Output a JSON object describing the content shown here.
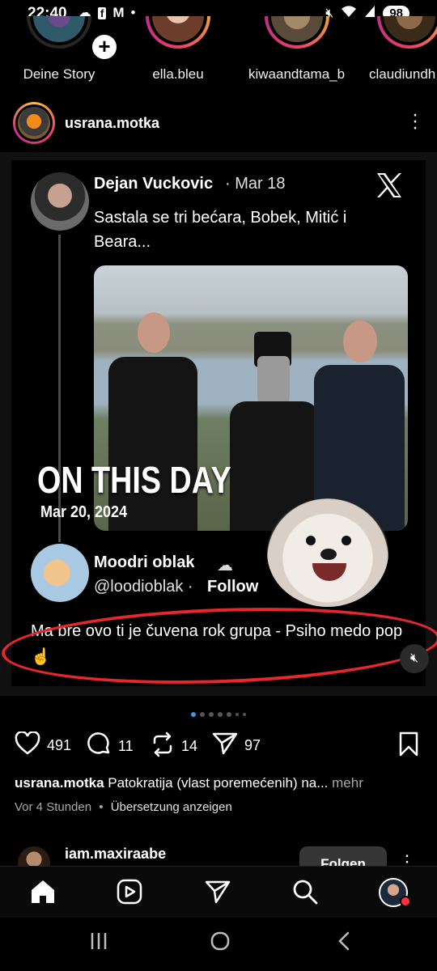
{
  "status": {
    "time": "22:40",
    "battery": "98",
    "left_icons": [
      "cloud-icon",
      "facebook-icon",
      "gmail-icon",
      "dot-icon"
    ],
    "right_icons": [
      "mute-icon",
      "wifi-icon",
      "signal-icon",
      "battery-icon"
    ]
  },
  "stories": [
    {
      "name": "Deine Story",
      "own": true
    },
    {
      "name": "ella.bleu"
    },
    {
      "name": "kiwaandtama_b..."
    },
    {
      "name": "claudiundh"
    }
  ],
  "post": {
    "username": "usrana.motka",
    "tweet": {
      "author": "Dejan Vuckovic",
      "date": "· Mar 18",
      "text": "Sastala se tri bećara, Bobek, Mitić i Beara...",
      "overlay_title": "ON THIS DAY",
      "overlay_date": "Mar 20, 2024"
    },
    "reply": {
      "author": "Moodri oblak",
      "handle": "@loodioblak ·",
      "follow": "Follow",
      "text": "Ma bre ovo ti je čuvena rok grupa - Psiho medo pop ☝"
    },
    "likes": "491",
    "comments": "11",
    "reposts": "14",
    "shares": "97",
    "caption_user": "usrana.motka",
    "caption_text": "Patokratija (vlast poremećenih) na...",
    "caption_more": "mehr",
    "time_ago": "Vor 4 Stunden",
    "separator": "•",
    "translate": "Übersetzung anzeigen"
  },
  "next_post": {
    "username": "iam.maxiraabe",
    "follow_label": "Folgen"
  },
  "colors": {
    "accent": "#3897f0",
    "annotation_red": "#e8262b",
    "notification": "#ff3040"
  }
}
